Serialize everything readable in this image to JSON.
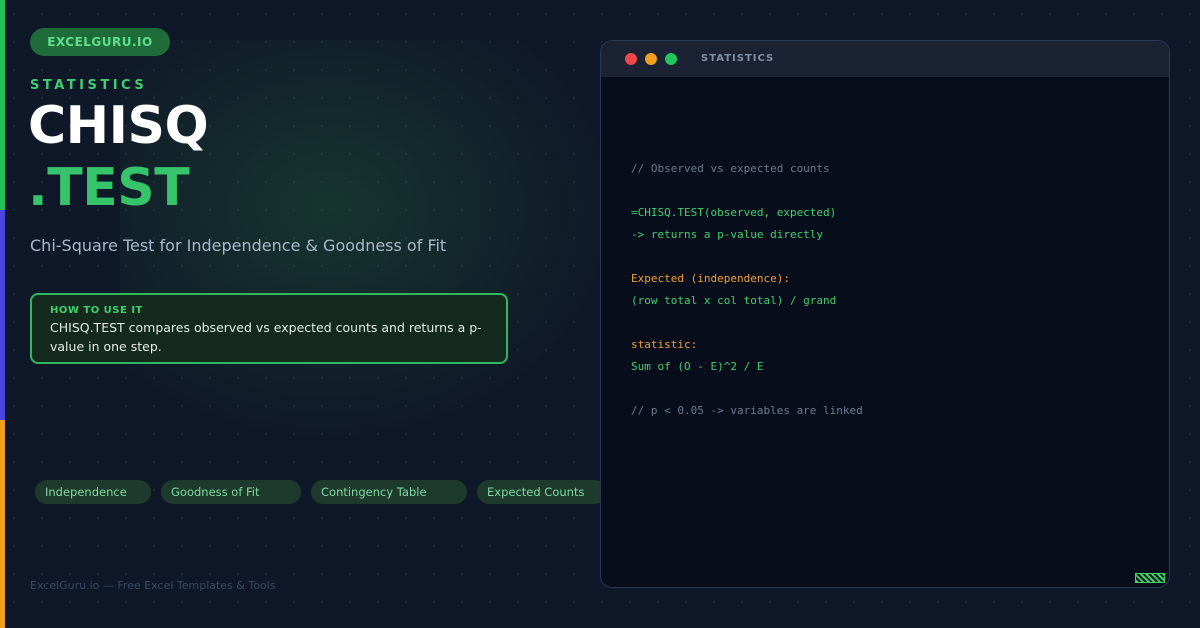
{
  "brand": "EXCELGURU.IO",
  "category": "STATISTICS",
  "title": {
    "line1": "CHISQ",
    "line2": ".TEST"
  },
  "subtitle": "Chi-Square Test for Independence & Goodness of Fit",
  "how_to": {
    "heading": "HOW TO USE IT",
    "body": "CHISQ.TEST compares observed vs expected counts and returns a p-value in one step."
  },
  "tags": [
    "Independence",
    "Goodness of Fit",
    "Contingency Table",
    "Expected Counts"
  ],
  "footer": "ExcelGuru.io — Free Excel Templates & Tools",
  "terminal": {
    "title": "STATISTICS",
    "lines": [
      "// Observed vs expected counts",
      "=CHISQ.TEST(observed, expected)",
      "-> returns a p-value directly",
      "Expected (independence):",
      "(row total x col total) / grand",
      "statistic:",
      "Sum of (O - E)^2 / E",
      "// p < 0.05 -> variables are linked"
    ]
  },
  "colors": {
    "accent_green": "#36c46a",
    "accent_blue": "#4a45e0",
    "accent_orange": "#f0a020",
    "background": "#0f1828"
  }
}
